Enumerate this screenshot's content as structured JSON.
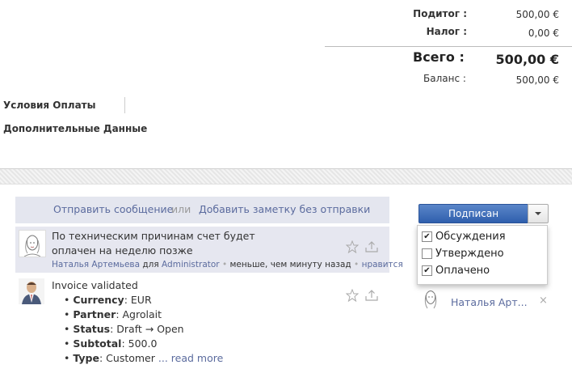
{
  "totals": {
    "subtotal_label": "Подитог :",
    "subtotal_value": "500,00 €",
    "tax_label": "Налог :",
    "tax_value": "0,00 €",
    "total_label": "Всего :",
    "total_value": "500,00 €",
    "balance_label": "Баланс :",
    "balance_value": "500,00 €"
  },
  "sections": {
    "payment_terms": "Условия Оплаты",
    "additional_data": "Дополнительные Данные"
  },
  "chatter": {
    "send_message": "Отправить сообщение",
    "or": "или",
    "add_note": "Добавить заметку без отправки",
    "messages": [
      {
        "text": "По техническим причинам счет будет оплачен на неделю позже",
        "author": "Наталья Артемьева",
        "for_word": "для",
        "recipient": "Administrator",
        "time": "меньше, чем минуту назад",
        "like": "нравится"
      },
      {
        "title": "Invoice validated",
        "fields": [
          {
            "name": "Currency",
            "value": "EUR"
          },
          {
            "name": "Partner",
            "value": "Agrolait"
          },
          {
            "name": "Status",
            "value": "Draft → Open"
          },
          {
            "name": "Subtotal",
            "value": "500.0"
          },
          {
            "name": "Type",
            "value": "Customer"
          }
        ],
        "ellipsis": "...",
        "read_more": "read more"
      }
    ]
  },
  "followers": {
    "button_label": "Подписан",
    "subtypes": [
      {
        "label": "Обсуждения",
        "checked": true
      },
      {
        "label": "Утверждено",
        "checked": false
      },
      {
        "label": "Оплачено",
        "checked": true
      }
    ],
    "check_mark": "✔",
    "list": [
      {
        "name": "Наталья Арт..."
      }
    ],
    "remove_glyph": "×"
  },
  "colors": {
    "link": "#5b6b9e",
    "accent_button": "#2f5fad",
    "compose_bg": "#e4e6ef"
  }
}
